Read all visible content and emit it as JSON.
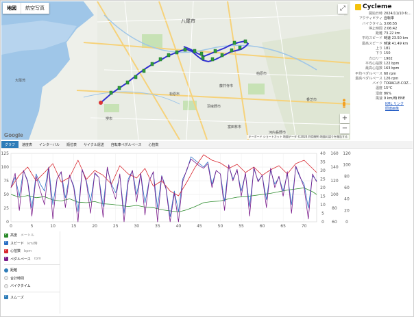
{
  "map": {
    "tabs": [
      "地図",
      "航空写真"
    ],
    "labels": {
      "yao": "八尾市",
      "sakai": "堺市",
      "matsubara": "松原市",
      "habikino": "羽曳野市",
      "kashiwara": "柏原市",
      "fujiidera": "藤井寺市",
      "osaka_bay": "大阪湾",
      "kashiba": "香芝市",
      "tondabayashi": "富田林市",
      "kawachinagano": "河内長野市"
    },
    "google": "Google",
    "attribution": "キーボード ショートカット  地図データ ©2024  利用規約  地図の誤りを報告する"
  },
  "info": {
    "app_name": "Cycleme",
    "rows": [
      {
        "k": "開始日時",
        "v": "2024/11/10 6:..."
      },
      {
        "k": "アクティビティ",
        "v": "自転車"
      },
      {
        "k": "バイクタイム",
        "v": "3:06:55"
      },
      {
        "k": "停止時間",
        "v": "2:06:42"
      },
      {
        "k": "距離",
        "v": "73.22 km"
      },
      {
        "k": "平均スピード",
        "v": "時速 23.50 km"
      },
      {
        "k": "最高スピード",
        "v": "時速 41.49 km"
      },
      {
        "k": "上り",
        "v": "181"
      },
      {
        "k": "下り",
        "v": "150"
      },
      {
        "k": "カロリー",
        "v": "1902"
      },
      {
        "k": "平均心拍数",
        "v": "122 bpm"
      },
      {
        "k": "最高心拍数",
        "v": "163 bpm"
      },
      {
        "k": "平均ペダルペース",
        "v": "60 rpm"
      },
      {
        "k": "最高ペダルペース",
        "v": "126 rpm"
      },
      {
        "k": "バイク",
        "v": "TORACLE-COZ..."
      },
      {
        "k": "温度",
        "v": "15°C"
      },
      {
        "k": "湿度",
        "v": "86%"
      },
      {
        "k": "風速",
        "v": "9 km/時 ENE"
      }
    ],
    "kml_link": "KML リンク",
    "export_link": "関連画像"
  },
  "tabs": [
    "グラフ",
    "速度表",
    "インターバル",
    "順位表",
    "サイクル運送",
    "自転車ペダルペース",
    "心拍数"
  ],
  "legend": {
    "series": [
      {
        "label": "高度",
        "unit": "メートル",
        "color": "#2a8a2a"
      },
      {
        "label": "スピード",
        "unit": "km/時",
        "color": "#2a6fc4"
      },
      {
        "label": "心拍数",
        "unit": "bpm",
        "color": "#d8262e"
      },
      {
        "label": "ペダルペース",
        "unit": "rpm",
        "color": "#7a1a8a"
      }
    ],
    "x_modes": [
      "距離",
      "合計時間",
      "バイクタイム"
    ],
    "smooth_label": "スムーズ"
  },
  "chart_data": {
    "type": "line",
    "x": {
      "label": "",
      "ticks": [
        0,
        5,
        10,
        15,
        20,
        25,
        30,
        35,
        40,
        45,
        50,
        55,
        60,
        65,
        70
      ],
      "range": [
        0,
        73
      ]
    },
    "y_left": {
      "ticks": [
        0,
        25,
        50,
        75,
        100,
        125
      ],
      "range": [
        0,
        125
      ]
    },
    "y_right1": {
      "ticks": [
        0,
        5,
        10,
        15,
        20,
        25,
        30,
        35,
        40
      ],
      "range": [
        0,
        40
      ]
    },
    "y_right2": {
      "ticks": [
        60,
        80,
        100,
        120,
        140,
        160
      ],
      "range": [
        60,
        160
      ]
    },
    "y_right3": {
      "ticks": [
        0,
        20,
        40,
        60,
        80,
        100,
        120
      ],
      "range": [
        0,
        120
      ]
    },
    "series": [
      {
        "name": "高度",
        "axis": "y_left",
        "color": "#2a8a2a",
        "x": [
          0,
          2,
          4,
          6,
          8,
          10,
          12,
          14,
          16,
          18,
          20,
          22,
          24,
          26,
          28,
          30,
          32,
          34,
          36,
          38,
          40,
          42,
          44,
          46,
          48,
          50,
          52,
          54,
          56,
          58,
          60,
          62,
          64,
          66,
          68,
          70,
          72,
          73
        ],
        "values": [
          50,
          45,
          48,
          44,
          46,
          40,
          38,
          42,
          36,
          35,
          37,
          33,
          32,
          30,
          28,
          30,
          27,
          26,
          22,
          20,
          18,
          22,
          28,
          35,
          37,
          38,
          42,
          45,
          46,
          48,
          50,
          52,
          55,
          58,
          60,
          62,
          55,
          50
        ]
      },
      {
        "name": "スピード",
        "axis": "y_right1",
        "color": "#2a6fc4",
        "x": [
          0,
          1,
          2,
          3,
          4,
          5,
          6,
          7,
          8,
          9,
          10,
          11,
          12,
          13,
          14,
          15,
          16,
          17,
          18,
          19,
          20,
          21,
          22,
          23,
          24,
          25,
          26,
          27,
          28,
          29,
          30,
          31,
          32,
          33,
          34,
          35,
          36,
          37,
          38,
          39,
          40,
          41,
          42,
          43,
          44,
          45,
          46,
          47,
          48,
          49,
          50,
          51,
          52,
          53,
          54,
          55,
          56,
          57,
          58,
          59,
          60,
          61,
          62,
          63,
          64,
          65,
          66,
          67,
          68,
          69,
          70,
          71,
          72,
          73
        ],
        "values": [
          20,
          26,
          15,
          30,
          24,
          8,
          28,
          22,
          18,
          32,
          10,
          25,
          29,
          14,
          27,
          21,
          6,
          30,
          24,
          12,
          28,
          26,
          9,
          31,
          22,
          17,
          27,
          5,
          25,
          30,
          16,
          28,
          11,
          24,
          29,
          8,
          27,
          20,
          3,
          18,
          6,
          25,
          30,
          38,
          36,
          34,
          32,
          35,
          22,
          30,
          28,
          12,
          33,
          25,
          30,
          18,
          28,
          9,
          31,
          24,
          27,
          13,
          30,
          22,
          26,
          18,
          28,
          10,
          32,
          26,
          22,
          8,
          27,
          24
        ]
      },
      {
        "name": "心拍数",
        "axis": "y_right2",
        "color": "#d8262e",
        "x": [
          0,
          2,
          4,
          6,
          8,
          10,
          12,
          14,
          16,
          18,
          20,
          22,
          24,
          26,
          28,
          30,
          32,
          34,
          36,
          38,
          40,
          42,
          44,
          46,
          48,
          50,
          52,
          54,
          56,
          58,
          60,
          62,
          64,
          66,
          68,
          70,
          72,
          73
        ],
        "values": [
          110,
          128,
          140,
          120,
          132,
          145,
          118,
          125,
          150,
          122,
          135,
          128,
          115,
          142,
          130,
          124,
          138,
          112,
          120,
          105,
          98,
          118,
          140,
          158,
          150,
          146,
          138,
          144,
          132,
          140,
          128,
          136,
          142,
          130,
          145,
          150,
          138,
          132
        ]
      },
      {
        "name": "ペダルペース",
        "axis": "y_right3",
        "color": "#7a1a8a",
        "x": [
          0,
          1,
          2,
          3,
          4,
          5,
          6,
          7,
          8,
          9,
          10,
          11,
          12,
          13,
          14,
          15,
          16,
          17,
          18,
          19,
          20,
          21,
          22,
          23,
          24,
          25,
          26,
          27,
          28,
          29,
          30,
          31,
          32,
          33,
          34,
          35,
          36,
          37,
          38,
          39,
          40,
          41,
          42,
          43,
          44,
          45,
          46,
          47,
          48,
          49,
          50,
          51,
          52,
          53,
          54,
          55,
          56,
          57,
          58,
          59,
          60,
          61,
          62,
          63,
          64,
          65,
          66,
          67,
          68,
          69,
          70,
          71,
          72,
          73
        ],
        "values": [
          60,
          85,
          20,
          90,
          70,
          10,
          80,
          55,
          30,
          95,
          5,
          75,
          88,
          25,
          82,
          60,
          0,
          92,
          70,
          15,
          86,
          78,
          8,
          96,
          62,
          40,
          84,
          0,
          70,
          90,
          35,
          85,
          12,
          72,
          88,
          0,
          80,
          58,
          0,
          50,
          0,
          70,
          92,
          110,
          104,
          98,
          94,
          102,
          60,
          90,
          84,
          20,
          100,
          72,
          92,
          45,
          86,
          10,
          96,
          70,
          82,
          25,
          94,
          60,
          80,
          45,
          88,
          15,
          98,
          80,
          60,
          5,
          84,
          70
        ]
      }
    ]
  }
}
